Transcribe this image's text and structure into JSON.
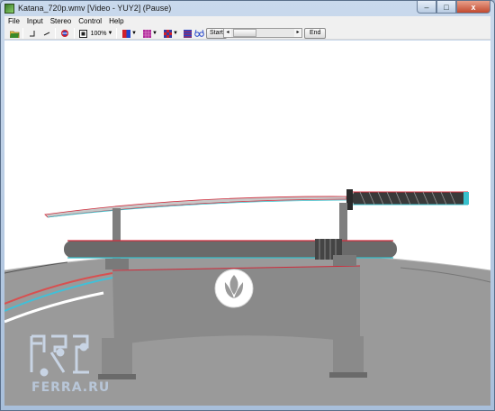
{
  "window": {
    "title": "Katana_720p.wmv [Video - YUY2] (Pause)",
    "controls": {
      "minimize": "–",
      "maximize": "□",
      "close": "x"
    }
  },
  "menu": [
    "File",
    "Input",
    "Stereo",
    "Control",
    "Help"
  ],
  "toolbar": {
    "zoom": "100%",
    "start_label": "Start",
    "end_label": "End",
    "icons": [
      "open-folder-icon",
      "left-angle-icon",
      "line-icon",
      "reload-icon",
      "fit-window-icon",
      "zoom-dropdown",
      "red-blue-anaglyph-icon",
      "pink-pattern-icon",
      "checker-pattern-icon",
      "blue-stripe-icon",
      "glasses-icon"
    ],
    "colors": {
      "red": "#d0202a",
      "blue": "#2244cc",
      "magenta": "#b02a9a",
      "violet": "#3a3aa0"
    }
  },
  "video": {
    "scene": "anaglyph-katana-on-stand",
    "watermark": "FERRA.RU",
    "colors": {
      "background": "#ffffff",
      "stand": "#8a8a8a",
      "scabbard": "#6a6a6a",
      "handle": "#3a3a3a",
      "floor": "#9a9a9a"
    }
  }
}
